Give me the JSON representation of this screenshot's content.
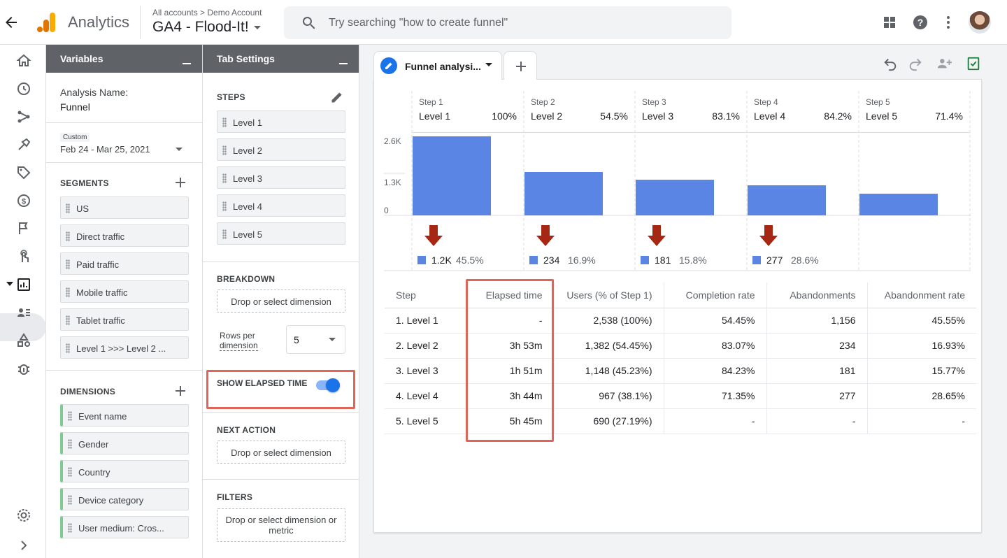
{
  "topbar": {
    "app_name": "Analytics",
    "breadcrumb": "All accounts > Demo Account",
    "property": "GA4 - Flood-It!",
    "search_placeholder": "Try searching \"how to create funnel\""
  },
  "variables": {
    "title": "Variables",
    "analysis_name_label": "Analysis Name:",
    "analysis_name": "Funnel",
    "date_badge": "Custom",
    "date_range": "Feb 24 - Mar 25, 2021",
    "segments_title": "SEGMENTS",
    "segments": [
      "US",
      "Direct traffic",
      "Paid traffic",
      "Mobile traffic",
      "Tablet traffic",
      "Level 1 >>> Level 2 ..."
    ],
    "dimensions_title": "DIMENSIONS",
    "dimensions": [
      "Event name",
      "Gender",
      "Country",
      "Device category",
      "User medium: Cros..."
    ]
  },
  "tab_settings": {
    "title": "Tab Settings",
    "steps_title": "STEPS",
    "steps": [
      "Level 1",
      "Level 2",
      "Level 3",
      "Level 4",
      "Level 5"
    ],
    "breakdown_title": "BREAKDOWN",
    "breakdown_drop": "Drop or select dimension",
    "rows_label_1": "Rows per",
    "rows_label_2": "dimension",
    "rows_value": "5",
    "elapsed_label": "SHOW ELAPSED TIME",
    "elapsed_on": true,
    "next_action_title": "NEXT ACTION",
    "next_action_drop": "Drop or select dimension",
    "filters_title": "FILTERS",
    "filters_drop": "Drop or select dimension or metric"
  },
  "tab": {
    "label": "Funnel analysi..."
  },
  "colors": {
    "bar": "#5b85e4",
    "arrow": "#a52714",
    "accent": "#1a73e8",
    "highlight": "#e06559"
  },
  "chart_data": {
    "type": "bar",
    "yticks": [
      "2.6K",
      "1.3K",
      "0"
    ],
    "ylim": [
      0,
      2600
    ],
    "steps": [
      {
        "step": "Step 1",
        "level": "Level 1",
        "pct": "100%",
        "value": 2538,
        "abandon": "1.2K",
        "abandon_pct": "45.5%"
      },
      {
        "step": "Step 2",
        "level": "Level 2",
        "pct": "54.5%",
        "value": 1382,
        "abandon": "234",
        "abandon_pct": "16.9%"
      },
      {
        "step": "Step 3",
        "level": "Level 3",
        "pct": "83.1%",
        "value": 1148,
        "abandon": "181",
        "abandon_pct": "15.8%"
      },
      {
        "step": "Step 4",
        "level": "Level 4",
        "pct": "84.2%",
        "value": 967,
        "abandon": "277",
        "abandon_pct": "28.6%"
      },
      {
        "step": "Step 5",
        "level": "Level 5",
        "pct": "71.4%",
        "value": 690,
        "abandon": "",
        "abandon_pct": ""
      }
    ]
  },
  "table": {
    "headers": [
      "Step",
      "Elapsed time",
      "Users (% of Step 1)",
      "Completion rate",
      "Abandonments",
      "Abandonment rate"
    ],
    "rows": [
      [
        "1. Level 1",
        "-",
        "2,538 (100%)",
        "54.45%",
        "1,156",
        "45.55%"
      ],
      [
        "2. Level 2",
        "3h 53m",
        "1,382 (54.45%)",
        "83.07%",
        "234",
        "16.93%"
      ],
      [
        "3. Level 3",
        "1h 51m",
        "1,148 (45.23%)",
        "84.23%",
        "181",
        "15.77%"
      ],
      [
        "4. Level 4",
        "3h 44m",
        "967 (38.1%)",
        "71.35%",
        "277",
        "28.65%"
      ],
      [
        "5. Level 5",
        "5h 45m",
        "690 (27.19%)",
        "-",
        "-",
        "-"
      ]
    ]
  }
}
